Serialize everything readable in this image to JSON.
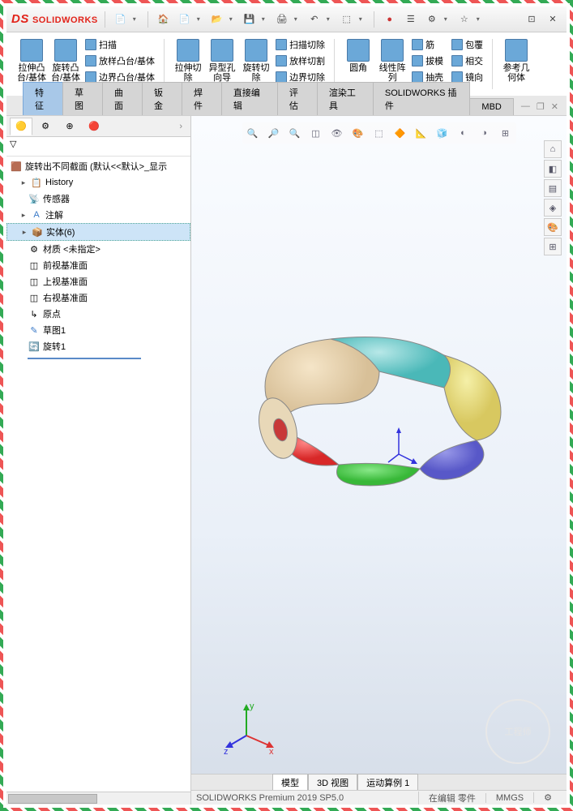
{
  "app": {
    "brand": "SOLIDWORKS"
  },
  "titlebar_icons": [
    "home",
    "new",
    "open",
    "save",
    "print",
    "undo",
    "redo",
    "select",
    "rebuild",
    "options",
    "settings"
  ],
  "ribbon": {
    "col1": [
      {
        "big": "拉伸凸台/基体"
      },
      {
        "big": "旋转凸台/基体"
      }
    ],
    "col1b": [
      "扫描",
      "放样凸台/基体",
      "边界凸台/基体"
    ],
    "col2": [
      {
        "big": "拉伸切除"
      },
      {
        "big": "异型孔向导"
      },
      {
        "big": "旋转切除"
      }
    ],
    "col2b": [
      "扫描切除",
      "放样切割",
      "边界切除"
    ],
    "col3": [
      {
        "big": "圆角"
      },
      {
        "big": "线性阵列"
      }
    ],
    "col3b": [
      "筋",
      "拔模",
      "抽壳"
    ],
    "col3c": [
      "包覆",
      "相交",
      "镜向"
    ],
    "col4": [
      {
        "big": "参考几何体"
      }
    ]
  },
  "tabs": [
    "特征",
    "草图",
    "曲面",
    "钣金",
    "焊件",
    "直接编辑",
    "评估",
    "渲染工具",
    "SOLIDWORKS 插件",
    "MBD"
  ],
  "active_tab": 0,
  "tree": {
    "root": "旋转出不同截面  (默认<<默认>_显示",
    "items": [
      {
        "icon": "📋",
        "label": "History",
        "exp": "▸"
      },
      {
        "icon": "📡",
        "label": "传感器"
      },
      {
        "icon": "A",
        "label": "注解",
        "exp": "▸"
      },
      {
        "icon": "📦",
        "label": "实体(6)",
        "exp": "▸",
        "sel": true
      },
      {
        "icon": "⚙",
        "label": "材质 <未指定>"
      },
      {
        "icon": "◫",
        "label": "前视基准面"
      },
      {
        "icon": "◫",
        "label": "上视基准面"
      },
      {
        "icon": "◫",
        "label": "右视基准面"
      },
      {
        "icon": "↳",
        "label": "原点"
      },
      {
        "icon": "✎",
        "label": "草图1"
      },
      {
        "icon": "🔄",
        "label": "旋转1"
      }
    ]
  },
  "view_toolbar": [
    "🔍",
    "🔎",
    "🔍",
    "🔲",
    "👁",
    "🎨",
    "⬚",
    "🔶",
    "📐",
    "🧊",
    "◐",
    "◑",
    "⊞"
  ],
  "side_toolbar": [
    "⌂",
    "◧",
    "▤",
    "◈",
    "🎨",
    "⊞"
  ],
  "bottom_tabs": [
    "模型",
    "3D 视图",
    "运动算例 1"
  ],
  "status": {
    "left": "SOLIDWORKS Premium 2019 SP5.0",
    "mode": "在编辑 零件",
    "units": "MMGS"
  },
  "watermark": "工程师",
  "triad": {
    "x": "x",
    "y": "y",
    "z": "z"
  }
}
